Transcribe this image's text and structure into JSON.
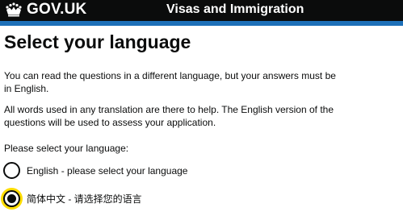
{
  "header": {
    "logo_text": "GOV.UK",
    "logo_icon": "crown-icon",
    "service_name": "Visas and Immigration"
  },
  "main": {
    "title": "Select your language",
    "paragraphs": [
      "You can read the questions in a different language, but your answers must be in English.",
      "All words used in any translation are there to help. The English version of the questions will be used to assess your application."
    ],
    "question": "Please select your language:",
    "options": [
      {
        "label": "English - please select your language",
        "selected": false
      },
      {
        "label": "简体中文 - 请选择您的语言",
        "selected": true
      }
    ]
  },
  "colors": {
    "header_bg": "#0b0c0c",
    "accent_bar": "#1d70b8",
    "focus": "#ffdd00",
    "text": "#0b0c0c"
  }
}
